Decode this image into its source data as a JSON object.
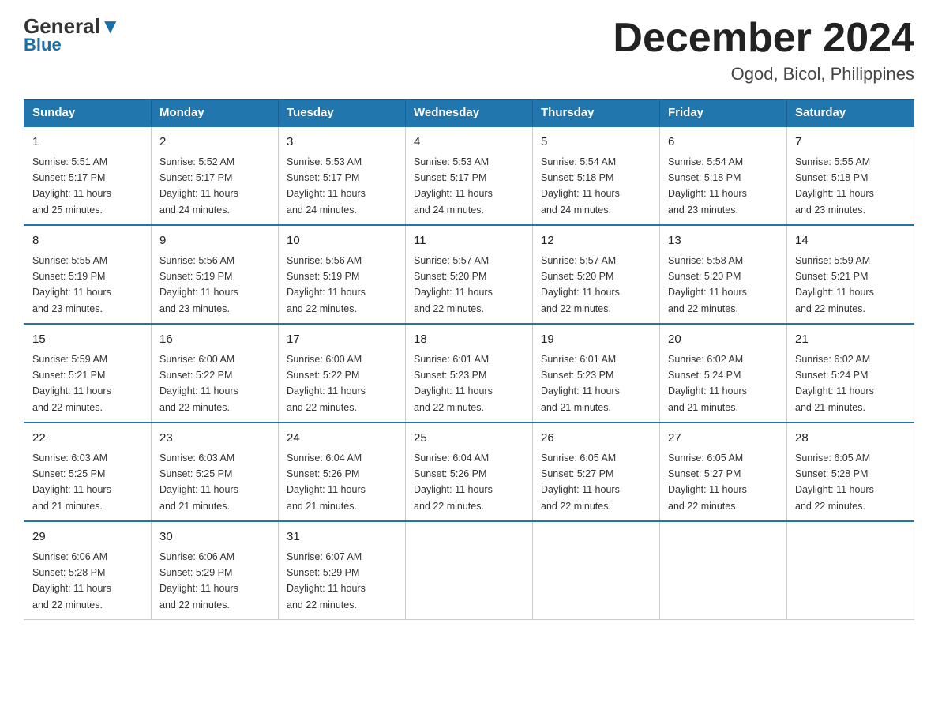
{
  "logo": {
    "general": "General",
    "blue": "Blue"
  },
  "header": {
    "month": "December 2024",
    "location": "Ogod, Bicol, Philippines"
  },
  "days_of_week": [
    "Sunday",
    "Monday",
    "Tuesday",
    "Wednesday",
    "Thursday",
    "Friday",
    "Saturday"
  ],
  "weeks": [
    [
      {
        "day": "1",
        "sunrise": "5:51 AM",
        "sunset": "5:17 PM",
        "daylight": "11 hours and 25 minutes."
      },
      {
        "day": "2",
        "sunrise": "5:52 AM",
        "sunset": "5:17 PM",
        "daylight": "11 hours and 24 minutes."
      },
      {
        "day": "3",
        "sunrise": "5:53 AM",
        "sunset": "5:17 PM",
        "daylight": "11 hours and 24 minutes."
      },
      {
        "day": "4",
        "sunrise": "5:53 AM",
        "sunset": "5:17 PM",
        "daylight": "11 hours and 24 minutes."
      },
      {
        "day": "5",
        "sunrise": "5:54 AM",
        "sunset": "5:18 PM",
        "daylight": "11 hours and 24 minutes."
      },
      {
        "day": "6",
        "sunrise": "5:54 AM",
        "sunset": "5:18 PM",
        "daylight": "11 hours and 23 minutes."
      },
      {
        "day": "7",
        "sunrise": "5:55 AM",
        "sunset": "5:18 PM",
        "daylight": "11 hours and 23 minutes."
      }
    ],
    [
      {
        "day": "8",
        "sunrise": "5:55 AM",
        "sunset": "5:19 PM",
        "daylight": "11 hours and 23 minutes."
      },
      {
        "day": "9",
        "sunrise": "5:56 AM",
        "sunset": "5:19 PM",
        "daylight": "11 hours and 23 minutes."
      },
      {
        "day": "10",
        "sunrise": "5:56 AM",
        "sunset": "5:19 PM",
        "daylight": "11 hours and 22 minutes."
      },
      {
        "day": "11",
        "sunrise": "5:57 AM",
        "sunset": "5:20 PM",
        "daylight": "11 hours and 22 minutes."
      },
      {
        "day": "12",
        "sunrise": "5:57 AM",
        "sunset": "5:20 PM",
        "daylight": "11 hours and 22 minutes."
      },
      {
        "day": "13",
        "sunrise": "5:58 AM",
        "sunset": "5:20 PM",
        "daylight": "11 hours and 22 minutes."
      },
      {
        "day": "14",
        "sunrise": "5:59 AM",
        "sunset": "5:21 PM",
        "daylight": "11 hours and 22 minutes."
      }
    ],
    [
      {
        "day": "15",
        "sunrise": "5:59 AM",
        "sunset": "5:21 PM",
        "daylight": "11 hours and 22 minutes."
      },
      {
        "day": "16",
        "sunrise": "6:00 AM",
        "sunset": "5:22 PM",
        "daylight": "11 hours and 22 minutes."
      },
      {
        "day": "17",
        "sunrise": "6:00 AM",
        "sunset": "5:22 PM",
        "daylight": "11 hours and 22 minutes."
      },
      {
        "day": "18",
        "sunrise": "6:01 AM",
        "sunset": "5:23 PM",
        "daylight": "11 hours and 22 minutes."
      },
      {
        "day": "19",
        "sunrise": "6:01 AM",
        "sunset": "5:23 PM",
        "daylight": "11 hours and 21 minutes."
      },
      {
        "day": "20",
        "sunrise": "6:02 AM",
        "sunset": "5:24 PM",
        "daylight": "11 hours and 21 minutes."
      },
      {
        "day": "21",
        "sunrise": "6:02 AM",
        "sunset": "5:24 PM",
        "daylight": "11 hours and 21 minutes."
      }
    ],
    [
      {
        "day": "22",
        "sunrise": "6:03 AM",
        "sunset": "5:25 PM",
        "daylight": "11 hours and 21 minutes."
      },
      {
        "day": "23",
        "sunrise": "6:03 AM",
        "sunset": "5:25 PM",
        "daylight": "11 hours and 21 minutes."
      },
      {
        "day": "24",
        "sunrise": "6:04 AM",
        "sunset": "5:26 PM",
        "daylight": "11 hours and 21 minutes."
      },
      {
        "day": "25",
        "sunrise": "6:04 AM",
        "sunset": "5:26 PM",
        "daylight": "11 hours and 22 minutes."
      },
      {
        "day": "26",
        "sunrise": "6:05 AM",
        "sunset": "5:27 PM",
        "daylight": "11 hours and 22 minutes."
      },
      {
        "day": "27",
        "sunrise": "6:05 AM",
        "sunset": "5:27 PM",
        "daylight": "11 hours and 22 minutes."
      },
      {
        "day": "28",
        "sunrise": "6:05 AM",
        "sunset": "5:28 PM",
        "daylight": "11 hours and 22 minutes."
      }
    ],
    [
      {
        "day": "29",
        "sunrise": "6:06 AM",
        "sunset": "5:28 PM",
        "daylight": "11 hours and 22 minutes."
      },
      {
        "day": "30",
        "sunrise": "6:06 AM",
        "sunset": "5:29 PM",
        "daylight": "11 hours and 22 minutes."
      },
      {
        "day": "31",
        "sunrise": "6:07 AM",
        "sunset": "5:29 PM",
        "daylight": "11 hours and 22 minutes."
      },
      null,
      null,
      null,
      null
    ]
  ],
  "labels": {
    "sunrise": "Sunrise:",
    "sunset": "Sunset:",
    "daylight": "Daylight:"
  }
}
